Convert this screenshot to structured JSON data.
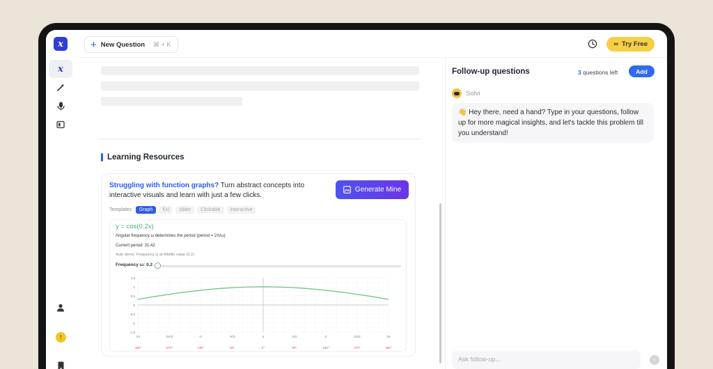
{
  "topbar": {
    "new_question_label": "New Question",
    "shortcut": "⌘ + K",
    "try_free_label": "Try Free"
  },
  "main": {
    "section_title": "Learning Resources",
    "card": {
      "highlight": "Struggling with function graphs?",
      "text": " Turn abstract concepts into interactive visuals and learn with just a few clicks.",
      "generate_label": "Generate Mine",
      "templates_label": "Templates:",
      "templates": [
        "Graph",
        "f(x)",
        "slider",
        "Clickable",
        "interactive"
      ],
      "active_template": "Graph"
    },
    "demo": {
      "title": "y = cos(0.2x)",
      "line1": "Angular frequency ω determines the period (period = 2π/ω)",
      "line2": "Current period: 31.42",
      "line3": "Auto demo: Frequency ω at Middle value (0.2)",
      "freq_label": "Frequency ω: 0.2",
      "frequency": 0.2
    }
  },
  "panel": {
    "title": "Follow-up questions",
    "questions_left_count": "3",
    "questions_left_text": " questions left",
    "add_label": "Add",
    "bot_name": "Solvi",
    "message": "👋 Hey there, need a hand? Type in your questions, follow up for more magical insights, and let's tackle this problem till you understand!",
    "ask_placeholder": "Ask follow-up..."
  },
  "chart_data": {
    "type": "line",
    "title": "",
    "xlabel": "",
    "ylabel": "",
    "x_ticks": [
      "-2π",
      "-3π/2",
      "-π",
      "-π/2",
      "0",
      "π/2",
      "π",
      "3π/2",
      "2π"
    ],
    "x_degree_ticks": [
      "-360°",
      "-270°",
      "-180°",
      "-90°",
      "0°",
      "90°",
      "180°",
      "270°",
      "360°"
    ],
    "y_ticks": [
      "1.5",
      "1",
      "0.5",
      "0",
      "-0.5",
      "-1",
      "-1.5"
    ],
    "xlim": [
      -6.2832,
      6.2832
    ],
    "ylim": [
      -1.5,
      1.5
    ],
    "grid": true,
    "series": [
      {
        "color": "#7cc48a",
        "x": [
          -6.2832,
          -4.7124,
          -3.1416,
          -1.5708,
          0,
          1.5708,
          3.1416,
          4.7124,
          6.2832
        ],
        "values": [
          0.309,
          0.588,
          0.809,
          0.951,
          1,
          0.951,
          0.809,
          0.588,
          0.309
        ]
      }
    ]
  }
}
